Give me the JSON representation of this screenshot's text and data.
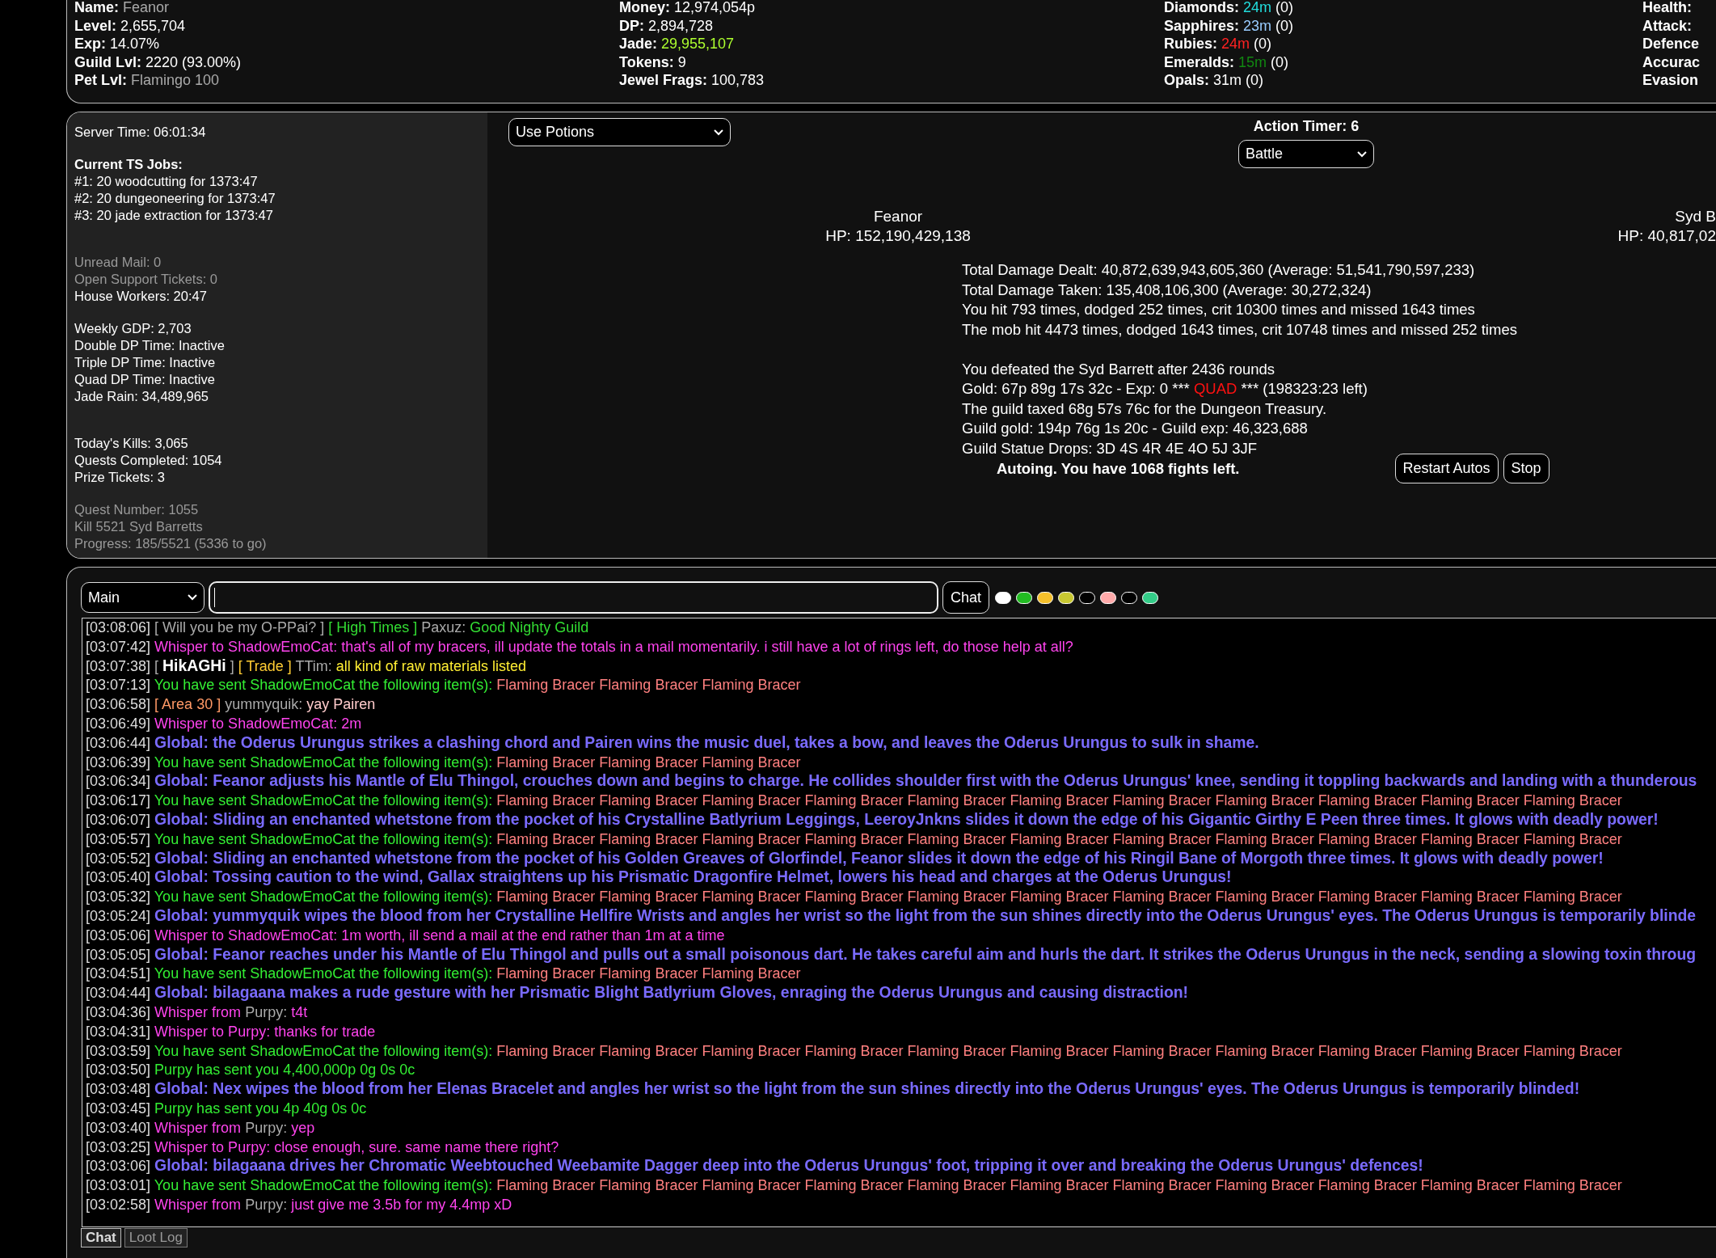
{
  "stats_columns": [
    [
      {
        "label": "Name:",
        "value": "Feanor",
        "color": "#aaaaaa"
      },
      {
        "label": "Level:",
        "value": "2,655,704",
        "color": "#ffffff"
      },
      {
        "label": "Exp:",
        "value": "14.07%",
        "color": "#ffffff"
      },
      {
        "label": "Guild Lvl:",
        "value": "2220 (93.00%)",
        "color": "#ffffff"
      },
      {
        "label": "Pet Lvl:",
        "value": "Flamingo 100",
        "color": "#aaaaaa"
      }
    ],
    [
      {
        "label": "Money:",
        "value": "12,974,054p",
        "color": "#ffffff"
      },
      {
        "label": "DP:",
        "value": "2,894,728",
        "color": "#ffffff"
      },
      {
        "label": "Jade:",
        "value": "29,955,107",
        "color": "#adff2f"
      },
      {
        "label": "Tokens:",
        "value": "9",
        "color": "#ffffff"
      },
      {
        "label": "Jewel Frags:",
        "value": "100,783",
        "color": "#ffffff"
      }
    ],
    [
      {
        "label": "Diamonds:",
        "value": "24m",
        "extra": "(0)",
        "color": "#22dddd"
      },
      {
        "label": "Sapphires:",
        "value": "23m",
        "extra": "(0)",
        "color": "#99ccff"
      },
      {
        "label": "Rubies:",
        "value": "24m",
        "extra": "(0)",
        "color": "#ff2222"
      },
      {
        "label": "Emeralds:",
        "value": "15m",
        "extra": "(0)",
        "color": "#118811"
      },
      {
        "label": "Opals:",
        "value": "31m",
        "extra": "(0)",
        "color": "#ffffff"
      }
    ],
    [
      {
        "label": "Health:"
      },
      {
        "label": "Attack:"
      },
      {
        "label": "Defence"
      },
      {
        "label": "Accurac"
      },
      {
        "label": "Evasion"
      }
    ]
  ],
  "info_sections": [
    [
      {
        "kind": "text",
        "text": "Server Time: 06:01:34"
      }
    ],
    [
      {
        "kind": "heading",
        "text": "Current TS Jobs:"
      },
      {
        "kind": "text",
        "text": "#1: 20 woodcutting for 1373:47"
      },
      {
        "kind": "text",
        "text": "#2: 20 dungeoneering for 1373:47"
      },
      {
        "kind": "text",
        "text": "#3: 20 jade extraction for 1373:47"
      }
    ],
    [
      {
        "kind": "muted",
        "text": "Unread Mail: 0"
      },
      {
        "kind": "muted",
        "text": "Open Support Tickets: 0"
      },
      {
        "kind": "text",
        "text": "House Workers: 20:47"
      }
    ],
    [
      {
        "kind": "text",
        "text": "Weekly GDP: 2,703"
      },
      {
        "kind": "text",
        "text": "Double DP Time: Inactive"
      },
      {
        "kind": "text",
        "text": "Triple DP Time: Inactive"
      },
      {
        "kind": "text",
        "text": "Quad DP Time: Inactive"
      },
      {
        "kind": "text",
        "text": "Jade Rain: 34,489,965"
      }
    ],
    [
      {
        "kind": "text",
        "text": "Today's Kills: 3,065"
      },
      {
        "kind": "text",
        "text": "Quests Completed: 1054"
      },
      {
        "kind": "text",
        "text": "Prize Tickets: 3"
      }
    ],
    [
      {
        "kind": "muted",
        "text": "Quest Number: 1055"
      },
      {
        "kind": "muted",
        "text": "Kill 5521 Syd Barretts"
      },
      {
        "kind": "muted",
        "text": "Progress: 185/5521 (5336 to go)"
      }
    ]
  ],
  "potion_select": {
    "value": "Use Potions"
  },
  "action_timer": "Action Timer: 6",
  "action_select": {
    "value": "Battle"
  },
  "combatants": [
    {
      "name": "Feanor",
      "hp": "HP: 152,190,429,138"
    },
    {
      "name": "Syd B",
      "hp": "HP: 40,817,02"
    }
  ],
  "battle_log": [
    [
      [
        {
          "text": "Total Damage Dealt: 40,872,639,943,605,360 (Average: 51,541,790,597,233)",
          "color": "#ffffff"
        }
      ],
      [
        {
          "text": "Total Damage Taken: 135,408,106,300 (Average: 30,272,324)",
          "color": "#ffffff"
        }
      ],
      [
        {
          "text": "You hit 793 times, dodged 252 times, crit 10300 times and missed 1643 times",
          "color": "#ffffff"
        }
      ],
      [
        {
          "text": "The mob hit 4473 times, dodged 1643 times, crit 10748 times and missed 252 times",
          "color": "#ffffff"
        }
      ]
    ],
    [
      [
        {
          "text": "You defeated the Syd Barrett after 2436 rounds",
          "color": "#ffffff"
        }
      ],
      [
        {
          "text": "Gold: 67p 89g 17s 32c - Exp: 0 *** ",
          "color": "#ffffff"
        },
        {
          "text": "QUAD",
          "color": "#ff1111"
        },
        {
          "text": " *** (198323:23 left)",
          "color": "#ffffff"
        }
      ],
      [
        {
          "text": "The guild taxed 68g 57s 76c for the Dungeon Treasury.",
          "color": "#ffffff"
        }
      ],
      [
        {
          "text": "Guild gold: 194p 76g 1s 20c - Guild exp: 46,323,688",
          "color": "#ffffff"
        }
      ],
      [
        {
          "text": "Guild Statue Drops: 3D 4S 4R 4E 4O 5J 3JF",
          "color": "#ffffff"
        }
      ]
    ]
  ],
  "auto_status": "Autoing. You have 1068 fights left.",
  "buttons": [
    "Restart Autos",
    "Stop"
  ],
  "channel_select": {
    "value": "Main"
  },
  "chat_button": "Chat",
  "color_filters": [
    {
      "color": "#ffffff"
    },
    {
      "color": "#22bb22"
    },
    {
      "color": "#f5c02b"
    },
    {
      "color": "#c8c832"
    },
    {
      "color": "#000000"
    },
    {
      "color": "#ffaaaa"
    },
    {
      "color": "#000000"
    },
    {
      "color": "#33cc88"
    }
  ],
  "chat": [
    {
      "time": "[03:08:06]",
      "parts": [
        {
          "text": "[ Will you be my O-PPai? ] ",
          "color": "#aaaaaa"
        },
        {
          "text": "[ High Times ]",
          "color": "#33dd33"
        },
        {
          "text": " Paxuz: ",
          "color": "#aaaaaa"
        },
        {
          "text": "Good Nighty Guild",
          "color": "#33dd33"
        }
      ]
    },
    {
      "time": "[03:07:42]",
      "parts": [
        {
          "text": "Whisper to ShadowEmoCat: that's all of my bracers, ill update the totals in a mail momentarily. i still have a lot of rings left, do those help at all?",
          "color": "#ff44ee"
        }
      ]
    },
    {
      "time": "[03:07:38]",
      "parts": [
        {
          "text": "[ ",
          "color": "#aaaaaa"
        },
        {
          "text": "HikAGHi",
          "color": "#ffffff",
          "bold": true
        },
        {
          "text": " ] ",
          "color": "#aaaaaa"
        },
        {
          "text": "[ Trade ]",
          "color": "#ffcc33"
        },
        {
          "text": " TTim: ",
          "color": "#aaaaaa"
        },
        {
          "text": "all kind of raw materials listed",
          "color": "#ffee33"
        }
      ]
    },
    {
      "time": "[03:07:13]",
      "parts": [
        {
          "text": "You have sent ShadowEmoCat the following item(s): ",
          "color": "#33ee33"
        },
        {
          "text": "Flaming Bracer Flaming Bracer Flaming Bracer",
          "color": "#ff8080"
        }
      ]
    },
    {
      "time": "[03:06:58]",
      "parts": [
        {
          "text": "[ Area 30 ]",
          "color": "#ff9966"
        },
        {
          "text": " yummyquik: ",
          "color": "#aaaaaa"
        },
        {
          "text": "yay Pairen",
          "color": "#ffcccc"
        }
      ]
    },
    {
      "time": "[03:06:49]",
      "parts": [
        {
          "text": "Whisper to ShadowEmoCat: 2m",
          "color": "#ff44ee"
        }
      ]
    },
    {
      "time": "[03:06:44]",
      "parts": [
        {
          "text": "Global: the Oderus Urungus strikes a clashing chord and Pairen wins the music duel, takes a bow, and leaves the Oderus Urungus to sulk in shame.",
          "color": "#7a6bff",
          "bold": true
        }
      ]
    },
    {
      "time": "[03:06:39]",
      "parts": [
        {
          "text": "You have sent ShadowEmoCat the following item(s): ",
          "color": "#33ee33"
        },
        {
          "text": "Flaming Bracer Flaming Bracer Flaming Bracer",
          "color": "#ff8080"
        }
      ]
    },
    {
      "time": "[03:06:34]",
      "parts": [
        {
          "text": "Global: Feanor adjusts his Mantle of Elu Thingol, crouches down and begins to charge. He collides shoulder first with the Oderus Urungus' knee, sending it toppling backwards and landing with a thunderous",
          "color": "#7a6bff",
          "bold": true
        }
      ]
    },
    {
      "time": "[03:06:17]",
      "parts": [
        {
          "text": "You have sent ShadowEmoCat the following item(s): ",
          "color": "#33ee33"
        },
        {
          "text": "Flaming Bracer Flaming Bracer Flaming Bracer Flaming Bracer Flaming Bracer Flaming Bracer Flaming Bracer Flaming Bracer Flaming Bracer Flaming Bracer Flaming Bracer",
          "color": "#ff8080"
        }
      ]
    },
    {
      "time": "[03:06:07]",
      "parts": [
        {
          "text": "Global: Sliding an enchanted whetstone from the pocket of his Crystalline Batlyrium Leggings, LeeroyJnkns slides it down the edge of his Gigantic Girthy E Peen three times. It glows with deadly power!",
          "color": "#7a6bff",
          "bold": true
        }
      ]
    },
    {
      "time": "[03:05:57]",
      "parts": [
        {
          "text": "You have sent ShadowEmoCat the following item(s): ",
          "color": "#33ee33"
        },
        {
          "text": "Flaming Bracer Flaming Bracer Flaming Bracer Flaming Bracer Flaming Bracer Flaming Bracer Flaming Bracer Flaming Bracer Flaming Bracer Flaming Bracer Flaming Bracer",
          "color": "#ff8080"
        }
      ]
    },
    {
      "time": "[03:05:52]",
      "parts": [
        {
          "text": "Global: Sliding an enchanted whetstone from the pocket of his Golden Greaves of Glorfindel, Feanor slides it down the edge of his Ringil Bane of Morgoth three times. It glows with deadly power!",
          "color": "#7a6bff",
          "bold": true
        }
      ]
    },
    {
      "time": "[03:05:40]",
      "parts": [
        {
          "text": "Global: Tossing caution to the wind, Gallax straightens up his Prismatic Dragonfire Helmet, lowers his head and charges at the Oderus Urungus!",
          "color": "#7a6bff",
          "bold": true
        }
      ]
    },
    {
      "time": "[03:05:32]",
      "parts": [
        {
          "text": "You have sent ShadowEmoCat the following item(s): ",
          "color": "#33ee33"
        },
        {
          "text": "Flaming Bracer Flaming Bracer Flaming Bracer Flaming Bracer Flaming Bracer Flaming Bracer Flaming Bracer Flaming Bracer Flaming Bracer Flaming Bracer Flaming Bracer",
          "color": "#ff8080"
        }
      ]
    },
    {
      "time": "[03:05:24]",
      "parts": [
        {
          "text": "Global: yummyquik wipes the blood from her Crystalline Hellfire Wrists and angles her wrist so the light from the sun shines directly into the Oderus Urungus' eyes. The Oderus Urungus is temporarily blinde",
          "color": "#7a6bff",
          "bold": true
        }
      ]
    },
    {
      "time": "[03:05:06]",
      "parts": [
        {
          "text": "Whisper to ShadowEmoCat: 1m worth, ill send a mail at the end rather than 1m at a time",
          "color": "#ff44ee"
        }
      ]
    },
    {
      "time": "[03:05:05]",
      "parts": [
        {
          "text": "Global: Feanor reaches under his Mantle of Elu Thingol and pulls out a small poisonous dart. He takes careful aim and hurls the dart. It strikes the Oderus Urungus in the neck, sending a slowing toxin throug",
          "color": "#7a6bff",
          "bold": true
        }
      ]
    },
    {
      "time": "[03:04:51]",
      "parts": [
        {
          "text": "You have sent ShadowEmoCat the following item(s): ",
          "color": "#33ee33"
        },
        {
          "text": "Flaming Bracer Flaming Bracer Flaming Bracer",
          "color": "#ff8080"
        }
      ]
    },
    {
      "time": "[03:04:44]",
      "parts": [
        {
          "text": "Global: bilagaana makes a rude gesture with her Prismatic Blight Batlyrium Gloves, enraging the Oderus Urungus and causing distraction!",
          "color": "#7a6bff",
          "bold": true
        }
      ]
    },
    {
      "time": "[03:04:36]",
      "parts": [
        {
          "text": "Whisper from ",
          "color": "#ff44ee"
        },
        {
          "text": "Purpy: ",
          "color": "#aaaaaa"
        },
        {
          "text": "t4t",
          "color": "#ff44ee"
        }
      ]
    },
    {
      "time": "[03:04:31]",
      "parts": [
        {
          "text": "Whisper to Purpy: thanks for trade",
          "color": "#ff44ee"
        }
      ]
    },
    {
      "time": "[03:03:59]",
      "parts": [
        {
          "text": "You have sent ShadowEmoCat the following item(s): ",
          "color": "#33ee33"
        },
        {
          "text": "Flaming Bracer Flaming Bracer Flaming Bracer Flaming Bracer Flaming Bracer Flaming Bracer Flaming Bracer Flaming Bracer Flaming Bracer Flaming Bracer Flaming Bracer",
          "color": "#ff8080"
        }
      ]
    },
    {
      "time": "[03:03:50]",
      "parts": [
        {
          "text": "Purpy has sent you 4,400,000p 0g 0s 0c",
          "color": "#33ee33"
        }
      ]
    },
    {
      "time": "[03:03:48]",
      "parts": [
        {
          "text": "Global: Nex wipes the blood from her Elenas Bracelet and angles her wrist so the light from the sun shines directly into the Oderus Urungus' eyes. The Oderus Urungus is temporarily blinded!",
          "color": "#7a6bff",
          "bold": true
        }
      ]
    },
    {
      "time": "[03:03:45]",
      "parts": [
        {
          "text": "Purpy has sent you 4p 40g 0s 0c",
          "color": "#33ee33"
        }
      ]
    },
    {
      "time": "[03:03:40]",
      "parts": [
        {
          "text": "Whisper from ",
          "color": "#ff44ee"
        },
        {
          "text": "Purpy: ",
          "color": "#aaaaaa"
        },
        {
          "text": "yep",
          "color": "#ff44ee"
        }
      ]
    },
    {
      "time": "[03:03:25]",
      "parts": [
        {
          "text": "Whisper to Purpy: close enough, sure. same name there right?",
          "color": "#ff44ee"
        }
      ]
    },
    {
      "time": "[03:03:06]",
      "parts": [
        {
          "text": "Global: bilagaana drives her Chromatic Weebtouched Weebamite Dagger deep into the Oderus Urungus' foot, tripping it over and breaking the Oderus Urungus' defences!",
          "color": "#7a6bff",
          "bold": true
        }
      ]
    },
    {
      "time": "[03:03:01]",
      "parts": [
        {
          "text": "You have sent ShadowEmoCat the following item(s): ",
          "color": "#33ee33"
        },
        {
          "text": "Flaming Bracer Flaming Bracer Flaming Bracer Flaming Bracer Flaming Bracer Flaming Bracer Flaming Bracer Flaming Bracer Flaming Bracer Flaming Bracer Flaming Bracer",
          "color": "#ff8080"
        }
      ]
    },
    {
      "time": "[03:02:58]",
      "parts": [
        {
          "text": "Whisper from ",
          "color": "#ff44ee"
        },
        {
          "text": "Purpy: ",
          "color": "#aaaaaa"
        },
        {
          "text": "just give me 3.5b for my 4.4mp xD",
          "color": "#ff44ee"
        }
      ]
    }
  ],
  "chat_tabs": [
    {
      "label": "Chat",
      "selected": true
    },
    {
      "label": "Loot Log",
      "selected": false
    }
  ]
}
